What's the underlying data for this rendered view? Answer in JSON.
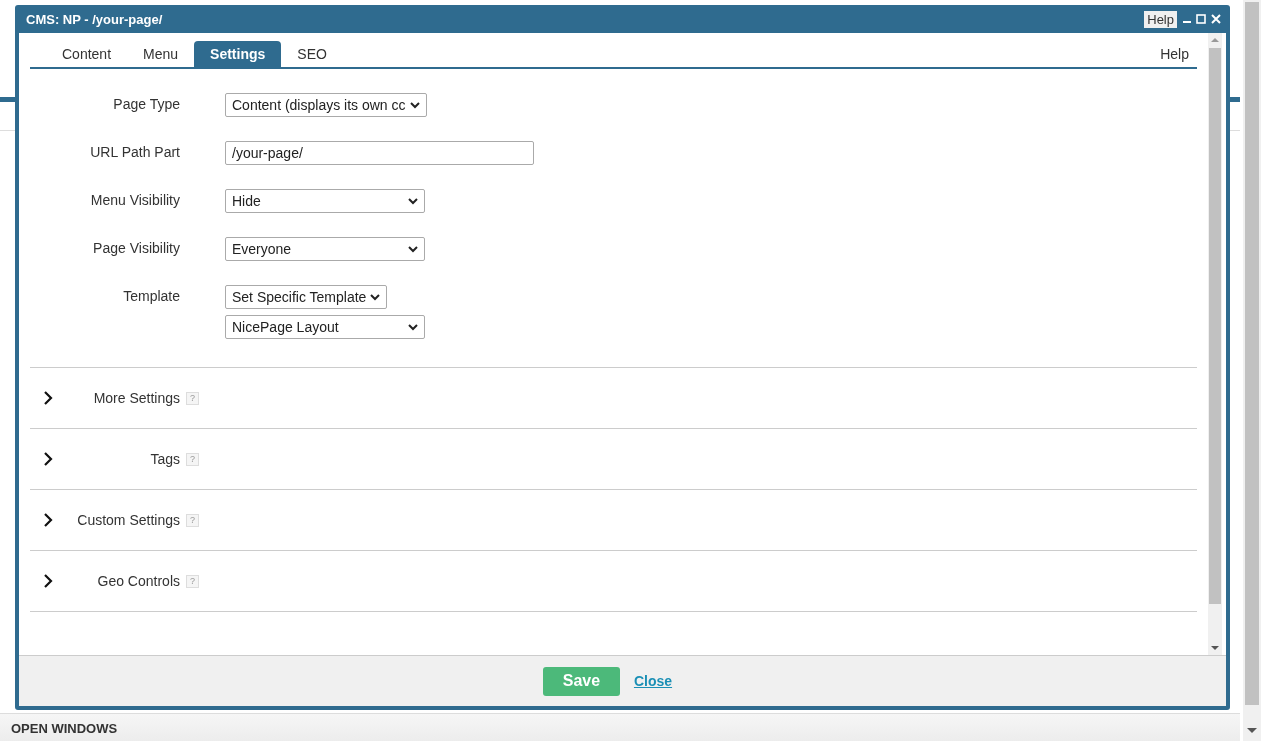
{
  "window": {
    "title": "CMS: NP - /your-page/",
    "help_button": "Help"
  },
  "tabs": [
    {
      "label": "Content",
      "selected": false
    },
    {
      "label": "Menu",
      "selected": false
    },
    {
      "label": "Settings",
      "selected": true
    },
    {
      "label": "SEO",
      "selected": false
    }
  ],
  "help_link": "Help",
  "fields": [
    {
      "label": "Page Type",
      "controls": [
        {
          "kind": "select",
          "value": "Content (displays its own cc"
        }
      ]
    },
    {
      "label": "URL Path Part",
      "controls": [
        {
          "kind": "text",
          "value": "/your-page/"
        }
      ]
    },
    {
      "label": "Menu Visibility",
      "controls": [
        {
          "kind": "select",
          "value": "Hide"
        }
      ]
    },
    {
      "label": "Page Visibility",
      "controls": [
        {
          "kind": "select",
          "value": "Everyone"
        }
      ]
    },
    {
      "label": "Template",
      "controls": [
        {
          "kind": "select-compact",
          "value": "Set Specific Template"
        },
        {
          "kind": "select",
          "value": "NicePage Layout"
        }
      ]
    }
  ],
  "sections": [
    {
      "label": "More Settings",
      "help": "?",
      "expanded": false
    },
    {
      "label": "Tags",
      "help": "?",
      "expanded": false
    },
    {
      "label": "Custom Settings",
      "help": "?",
      "expanded": false
    },
    {
      "label": "Geo Controls",
      "help": "?",
      "expanded": false
    }
  ],
  "footer": {
    "save": "Save",
    "close": "Close"
  },
  "taskbar": {
    "label": "OPEN WINDOWS"
  }
}
